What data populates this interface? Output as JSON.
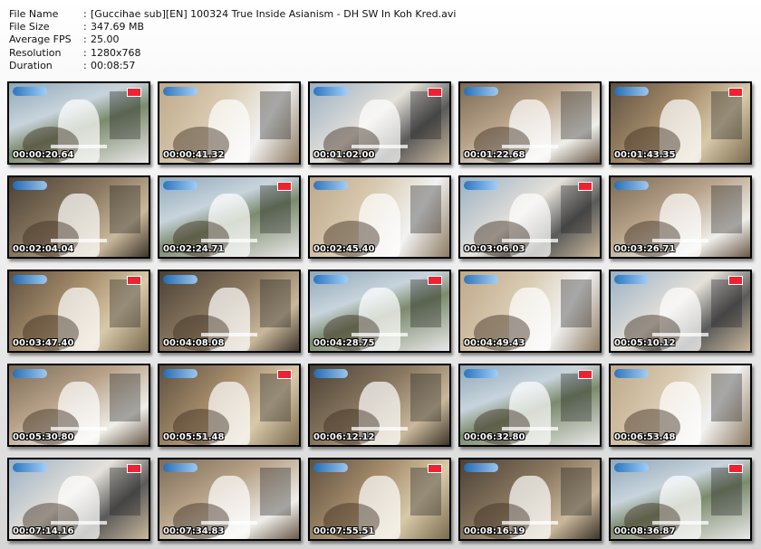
{
  "file_info": [
    {
      "key": "File Name",
      "value": "[Guccihae sub][EN] 100324 True Inside Asianism - DH SW In Koh Kred.avi"
    },
    {
      "key": "File Size",
      "value": "347.69 MB"
    },
    {
      "key": "Average FPS",
      "value": "25.00"
    },
    {
      "key": "Resolution",
      "value": "1280x768"
    },
    {
      "key": "Duration",
      "value": "00:08:57"
    }
  ],
  "separator": ":",
  "thumbnails": [
    "00:00:20.64",
    "00:00:41.32",
    "00:01:02.00",
    "00:01:22.68",
    "00:01:43.35",
    "00:02:04.04",
    "00:02:24.71",
    "00:02:45.40",
    "00:03:06.03",
    "00:03:26.71",
    "00:03:47.40",
    "00:04:08.08",
    "00:04:28.75",
    "00:04:49.43",
    "00:05:10.12",
    "00:05:30.80",
    "00:05:51.48",
    "00:06:12.12",
    "00:06:32.80",
    "00:06:53.48",
    "00:07:14.16",
    "00:07:34.83",
    "00:07:55.51",
    "00:08:16.19",
    "00:08:36.87"
  ]
}
